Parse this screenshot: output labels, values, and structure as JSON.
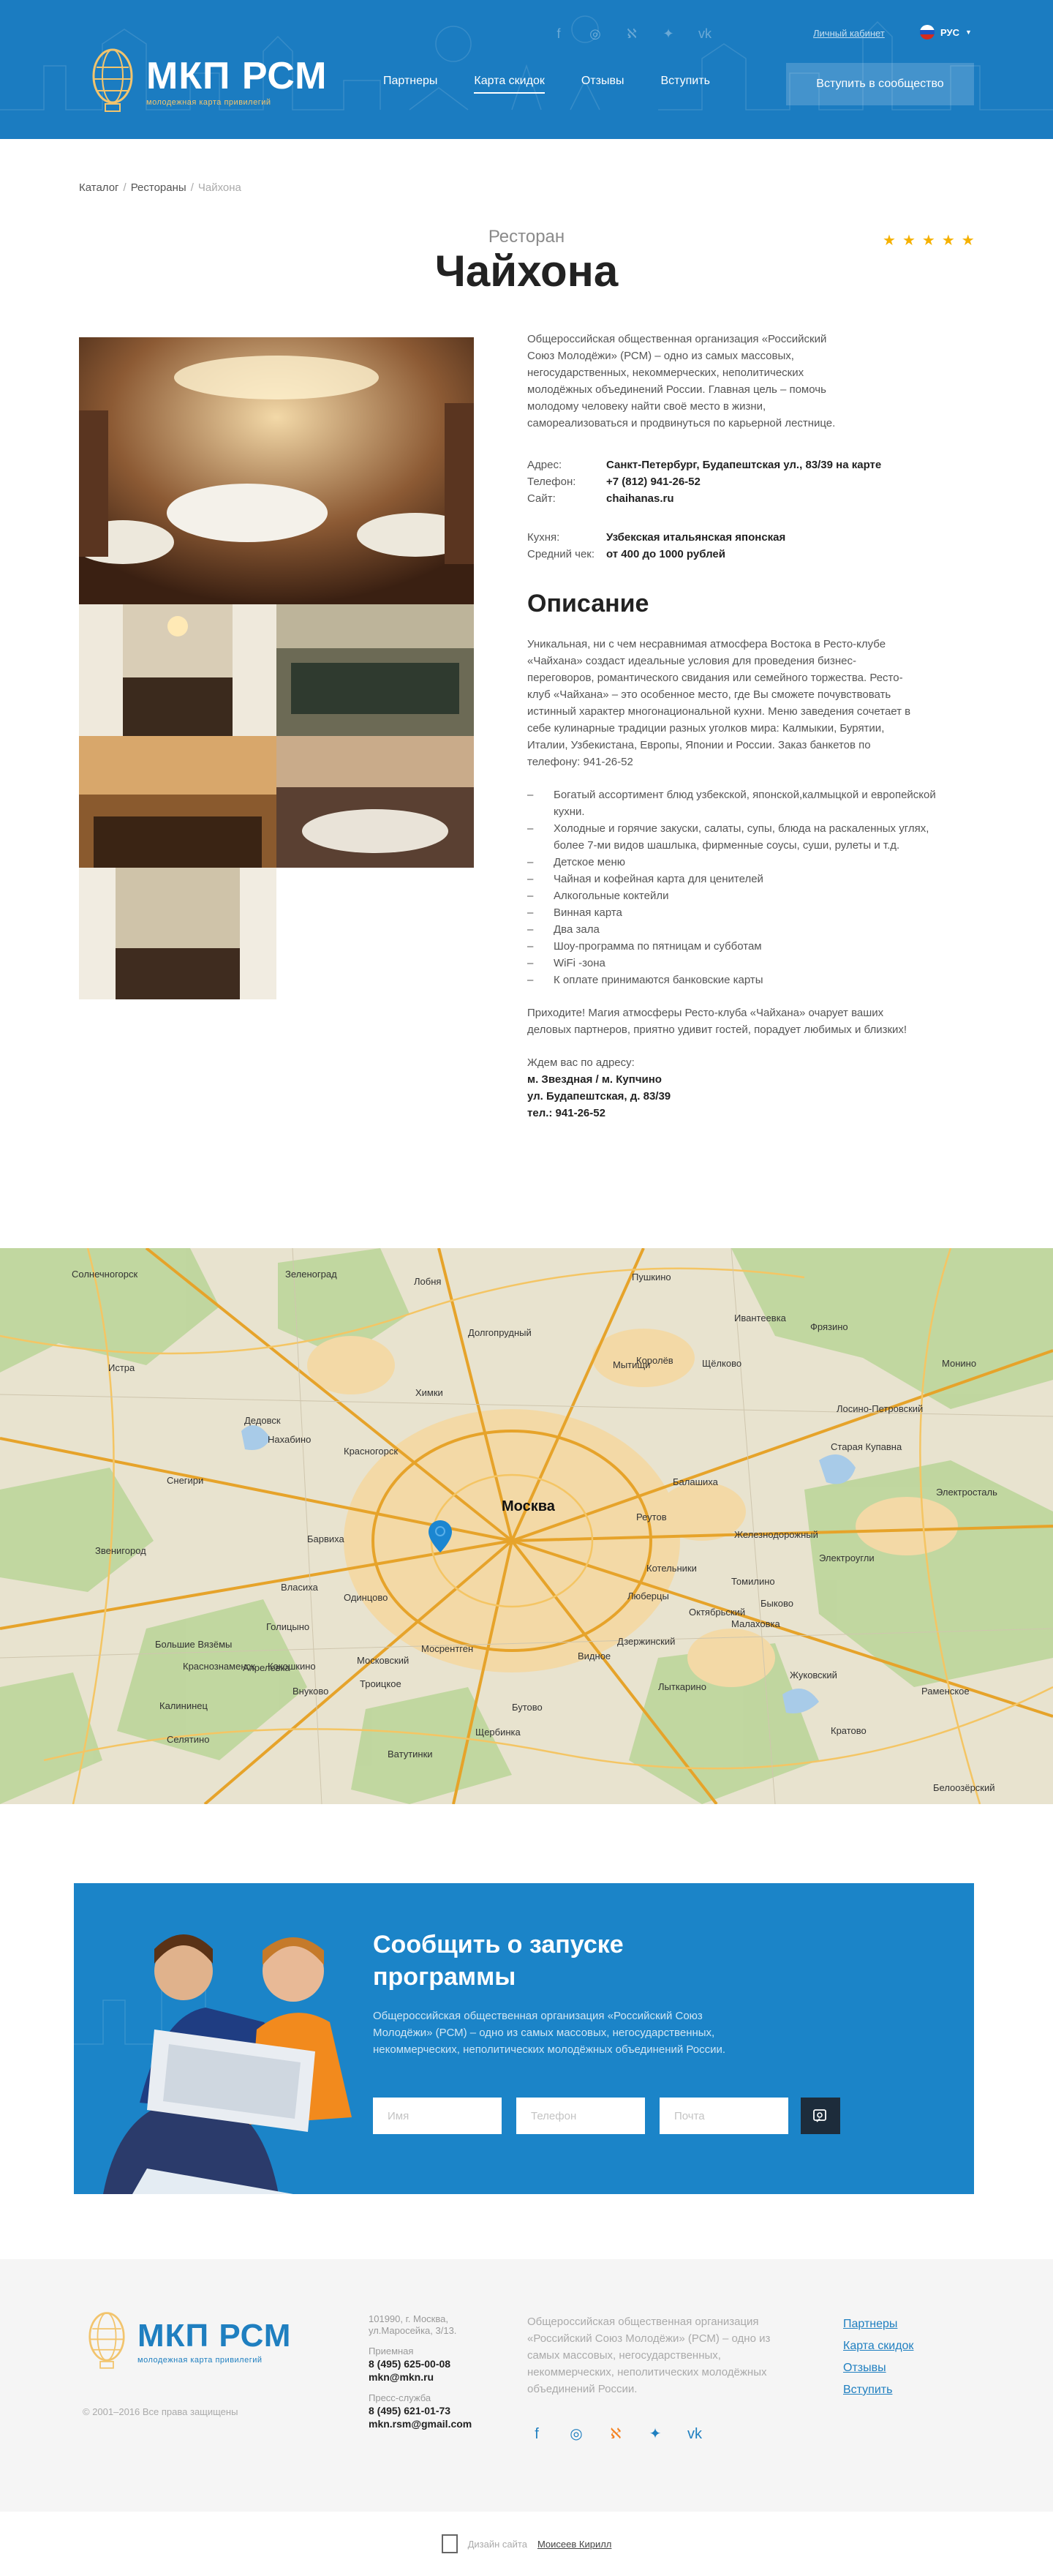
{
  "header": {
    "logo_title": "МКП РСМ",
    "logo_sub": "молодежная карта привилегий",
    "cabinet": "Личный кабинет",
    "lang": "РУС",
    "nav": [
      "Партнеры",
      "Карта скидок",
      "Отзывы",
      "Вступить"
    ],
    "join_button": "Вступить в сообщество",
    "socials": [
      "facebook-icon",
      "instagram-icon",
      "odnoklassniki-icon",
      "twitter-icon",
      "vk-icon"
    ]
  },
  "breadcrumb": {
    "items": [
      "Каталог",
      "Рестораны"
    ],
    "current": "Чайхона"
  },
  "page": {
    "category": "Ресторан",
    "title": "Чайхона",
    "rating": 5
  },
  "info": {
    "intro": "Общероссийская общественная организация «Российский Союз Молодёжи» (РСМ) – одно из самых массовых, негосударственных, некоммерческих, неполитических молодёжных объединений России. Главная цель – помочь молодому человеку найти своё место в жизни, самореализоваться и продвинуться по карьерной лестнице.",
    "address_label": "Адрес:",
    "address": "Санкт-Петербург, Будапештская ул., 83/39 на карте",
    "phone_label": "Телефон:",
    "phone": "+7 (812) 941-26-52",
    "site_label": "Сайт:",
    "site": "chaihanas.ru",
    "cuisine_label": "Кухня:",
    "cuisine": "Узбекская итальянская японская",
    "check_label": "Средний чек:",
    "check": "от 400 до 1000 рублей",
    "section_title": "Описание",
    "description": "Уникальная, ни с чем несравнимая атмосфера Востока в Ресто-клубе «Чайхана» создаст идеальные условия для проведения бизнес-переговоров, романтического свидания или семейного торжества. Ресто-клуб «Чайхана» – это особенное место, где Вы сможете почувствовать истинный характер многонациональной кухни. Меню заведения сочетает в себе кулинарные традиции разных уголков мира: Калмыкии, Бурятии, Италии, Узбекистана, Европы, Японии и России. Заказ банкетов по телефону: 941-26-52",
    "features": [
      "Богатый ассортимент блюд узбекской, японской,калмыцкой и европейской кухни.",
      "Холодные и горячие закуски, салаты, супы, блюда на раскаленных углях, более 7-ми видов шашлыка, фирменные соусы, суши, рулеты и т.д.",
      "Детское меню",
      "Чайная и кофейная карта для ценителей",
      "Алкогольные коктейли",
      "Винная карта",
      "Два зала",
      "Шоу-программа по пятницам и субботам",
      "WiFi -зона",
      "К оплате принимаются банковские карты"
    ],
    "closing": "Приходите! Магия атмосферы Ресто-клуба «Чайхана» очарует ваших деловых партнеров, приятно удивит гостей, порадует любимых и близких!",
    "addr_lead": "Ждем вас по адресу:",
    "addr_lines": [
      "м. Звездная / м. Купчино",
      "ул. Будапештская, д. 83/39",
      "тел.: 941-26-52"
    ]
  },
  "map": {
    "city": "Москва",
    "labels": [
      "Зеленоград",
      "Пушкино",
      "Мытищи",
      "Королёв",
      "Химки",
      "Долгопрудный",
      "Красногорск",
      "Балашиха",
      "Реутов",
      "Люберцы",
      "Одинцово",
      "Видное",
      "Дзержинский",
      "Лыткарино",
      "Щербинка",
      "Звенигород",
      "Истра",
      "Ивантеевка",
      "Фрязино",
      "Щёлково",
      "Электросталь",
      "Старая Купавна",
      "Жуковский",
      "Раменское",
      "Котельники",
      "Московский",
      "Внуково",
      "Апрелевка",
      "Селятино",
      "Власиха",
      "Голицыно",
      "Нахабино",
      "Лобня",
      "Лосино-Петровский",
      "Монино",
      "Железнодорожный",
      "Электроугли",
      "Кратово",
      "Быково",
      "Малаховка",
      "Томилино",
      "Октябрьский",
      "Белоозёрский",
      "Солнечногорск",
      "Дедовск",
      "Снегири",
      "Троицкое",
      "Большие Вязёмы",
      "Калининец",
      "Краснознаменск",
      "Кокошкино",
      "Мосрентген",
      "Бутово",
      "Ватутинки",
      "Барвиха"
    ]
  },
  "subscribe": {
    "title": "Сообщить о запуске программы",
    "text": "Общероссийская общественная организация «Российский Союз Молодёжи» (РСМ) – одно из самых массовых, негосударственных, некоммерческих, неполитических молодёжных объединений России.",
    "name_placeholder": "Имя",
    "phone_placeholder": "Телефон",
    "email_placeholder": "Почта"
  },
  "footer": {
    "logo_title": "МКП РСМ",
    "logo_sub": "молодежная карта привилегий",
    "copyright": "© 2001–2016 Все права защищены",
    "address": "101990, г. Москва, ул.Маросейка, 3/13.",
    "reception_label": "Приемная",
    "reception_phone": "8 (495) 625-00-08",
    "reception_email": "mkn@mkn.ru",
    "press_label": "Пресс-служба",
    "press_phone": "8 (495) 621-01-73",
    "press_email": "mkn.rsm@gmail.com",
    "about": "Общероссийская общественная организация «Российский Союз Молодёжи» (РСМ) – одно из самых массовых, негосударственных, некоммерческих, неполитических молодёжных объединений России.",
    "links": [
      "Партнеры",
      "Карта скидок",
      "Отзывы",
      "Вступить"
    ],
    "socials": [
      "facebook-icon",
      "instagram-icon",
      "odnoklassniki-icon",
      "twitter-icon",
      "vk-icon"
    ]
  },
  "bottom": {
    "design_label": "Дизайн сайта",
    "designer": "Моисеев Кирилл"
  },
  "colors": {
    "brand_blue": "#1b7cc1",
    "star": "#f5b100",
    "footer_link": "#1f7fc0"
  }
}
